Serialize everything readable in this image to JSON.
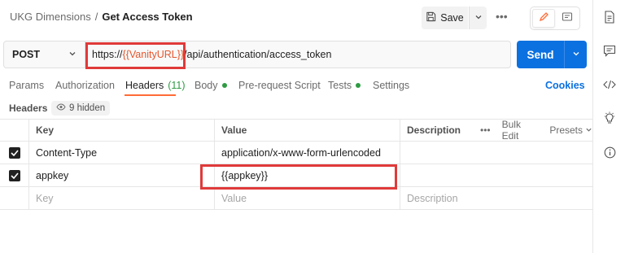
{
  "breadcrumb": {
    "parent": "UKG Dimensions",
    "separator": "/",
    "title": "Get Access Token"
  },
  "header_actions": {
    "save_label": "Save",
    "more_label": "•••"
  },
  "request": {
    "method": "POST",
    "url_prefix": "https://",
    "url_var": "{{VanityURL}}",
    "url_suffix": "/api/authentication/access_token",
    "send_label": "Send"
  },
  "tabs": {
    "params": "Params",
    "authorization": "Authorization",
    "headers": "Headers",
    "headers_count": "(11)",
    "body": "Body",
    "pre_request": "Pre-request Script",
    "tests": "Tests",
    "settings": "Settings",
    "cookies": "Cookies"
  },
  "headers_section": {
    "title": "Headers",
    "hidden_label": "9 hidden"
  },
  "table": {
    "columns": {
      "key": "Key",
      "value": "Value",
      "description": "Description",
      "more": "•••",
      "bulk_edit": "Bulk Edit",
      "presets": "Presets"
    },
    "rows": [
      {
        "key": "Content-Type",
        "value": "application/x-www-form-urlencoded",
        "description": "",
        "checked": true
      },
      {
        "key": "appkey",
        "value": "{{appkey}}",
        "description": "",
        "checked": true
      }
    ],
    "placeholder": {
      "key": "Key",
      "value": "Value",
      "description": "Description"
    }
  },
  "colors": {
    "accent": "#ff6c37",
    "send": "#0c71e0",
    "variable": "#e4572e",
    "annotation": "#e03a3a",
    "active_dot": "#2e9b43"
  },
  "icons": {
    "save": "save-icon",
    "caret": "chevron-down-icon",
    "edit": "pencil-icon",
    "comment": "comment-icon",
    "doc": "document-icon",
    "code": "code-icon",
    "bulb": "lightbulb-icon",
    "info": "info-icon",
    "eye": "eye-icon",
    "check": "check-icon"
  }
}
